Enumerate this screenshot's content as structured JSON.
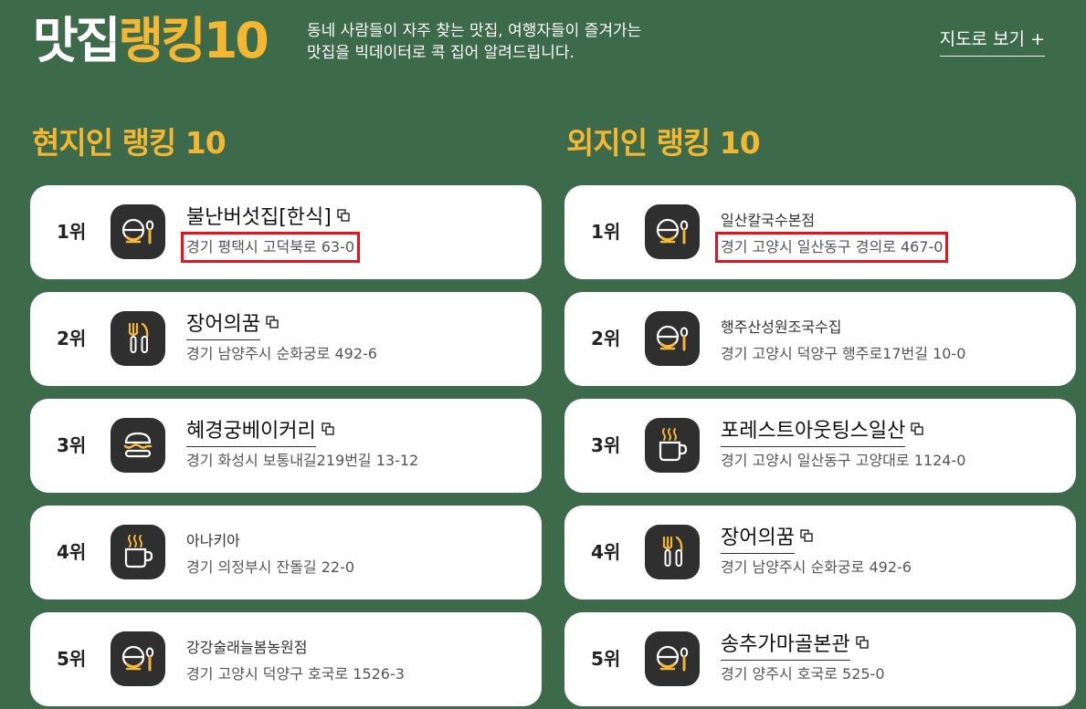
{
  "header": {
    "brand_white": "맛집",
    "brand_yellow": "랭킹10",
    "desc_line1": "동네 사람들이 자주 찾는 맛집, 여행자들이 즐겨가는",
    "desc_line2": "맛집을 빅데이터로 콕 집어 알려드립니다.",
    "map_link": "지도로 보기 +"
  },
  "colors": {
    "background": "#3c6a4a",
    "accent_yellow": "#f3b733",
    "highlight_red": "#e8111a",
    "icon_bg": "#2f2f2f"
  },
  "local": {
    "title": "현지인 랭킹 10",
    "items": [
      {
        "rank": "1위",
        "icon": "bowl-icon",
        "name": "불난버섯집[한식]",
        "addr": "경기 평택시 고덕북로 63-0",
        "link": true,
        "highlight": true
      },
      {
        "rank": "2위",
        "icon": "fork-knife-icon",
        "name": "장어의꿈",
        "addr": "경기 남양주시 순화궁로 492-6",
        "link": true,
        "highlight": false
      },
      {
        "rank": "3위",
        "icon": "burger-icon",
        "name": "혜경궁베이커리",
        "addr": "경기 화성시 보통내길219번길 13-12",
        "link": true,
        "highlight": false
      },
      {
        "rank": "4위",
        "icon": "coffee-icon",
        "name": "아나키아",
        "addr": "경기 의정부시 잔돌길 22-0",
        "link": false,
        "highlight": false
      },
      {
        "rank": "5위",
        "icon": "bowl-icon",
        "name": "강강술래늘봄농원점",
        "addr": "경기 고양시 덕양구 호국로 1526-3",
        "link": false,
        "highlight": false
      }
    ]
  },
  "visitor": {
    "title": "외지인 랭킹 10",
    "items": [
      {
        "rank": "1위",
        "icon": "bowl-icon",
        "name": "일산칼국수본점",
        "addr": "경기 고양시 일산동구 경의로 467-0",
        "link": false,
        "highlight": true
      },
      {
        "rank": "2위",
        "icon": "bowl-icon",
        "name": "행주산성원조국수집",
        "addr": "경기 고양시 덕양구 행주로17번길 10-0",
        "link": false,
        "highlight": false
      },
      {
        "rank": "3위",
        "icon": "coffee-icon",
        "name": "포레스트아웃팅스일산",
        "addr": "경기 고양시 일산동구 고양대로 1124-0",
        "link": true,
        "highlight": false
      },
      {
        "rank": "4위",
        "icon": "fork-knife-icon",
        "name": "장어의꿈",
        "addr": "경기 남양주시 순화궁로 492-6",
        "link": true,
        "highlight": false
      },
      {
        "rank": "5위",
        "icon": "bowl-icon",
        "name": "송추가마골본관",
        "addr": "경기 양주시 호국로 525-0",
        "link": true,
        "highlight": false
      }
    ]
  }
}
